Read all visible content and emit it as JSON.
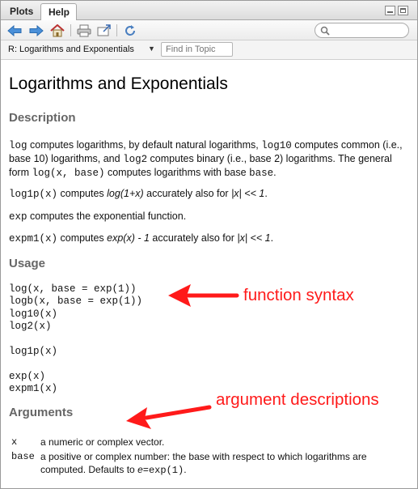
{
  "tabs": [
    {
      "label": "Plots",
      "active": false
    },
    {
      "label": "Help",
      "active": true
    }
  ],
  "toolbar": {
    "icons": [
      "back-arrow-icon",
      "forward-arrow-icon",
      "home-icon",
      "print-icon",
      "open-in-window-icon",
      "refresh-icon",
      "search-icon"
    ]
  },
  "topic": {
    "title": "R: Logarithms and Exponentials",
    "find_placeholder": "Find in Topic"
  },
  "doc": {
    "title": "Logarithms and Exponentials",
    "description_heading": "Description",
    "desc1": {
      "f1": "log",
      "t1": " computes logarithms, by default natural logarithms, ",
      "f2": "log10",
      "t2": " computes common (i.e., base 10) logarithms, and ",
      "f3": "log2",
      "t3": " computes binary (i.e., base 2) logarithms. The general form ",
      "f4": "log(x, base)",
      "t4": " computes logarithms with base ",
      "f5": "base",
      "t5": "."
    },
    "desc2": {
      "f1": "log1p(x)",
      "t1": " computes ",
      "i1": "log(1+x)",
      "t2": " accurately also for ",
      "i2": "|x| << 1",
      "t3": "."
    },
    "desc3": {
      "f1": "exp",
      "t1": " computes the exponential function."
    },
    "desc4": {
      "f1": "expm1(x)",
      "t1": " computes ",
      "i1": "exp(x) - 1",
      "t2": " accurately also for ",
      "i2": "|x| << 1",
      "t3": "."
    },
    "usage_heading": "Usage",
    "usage_lines": [
      "log(x, base = exp(1))",
      "logb(x, base = exp(1))",
      "log10(x)",
      "log2(x)",
      "",
      "log1p(x)",
      "",
      "exp(x)",
      "expm1(x)"
    ],
    "arguments_heading": "Arguments",
    "args": [
      {
        "name": "x",
        "desc1": "a numeric or complex vector.",
        "desc2": ""
      },
      {
        "name": "base",
        "desc1": "a positive or complex number: the base with respect to which logarithms are",
        "desc2a": "computed. Defaults to ",
        "desc2i": "e",
        "desc2c": "=exp(1)",
        "desc2d": "."
      }
    ]
  },
  "annotations": {
    "syntax_label": "function syntax",
    "args_label": "argument descriptions",
    "color": "#ff1a1a"
  }
}
